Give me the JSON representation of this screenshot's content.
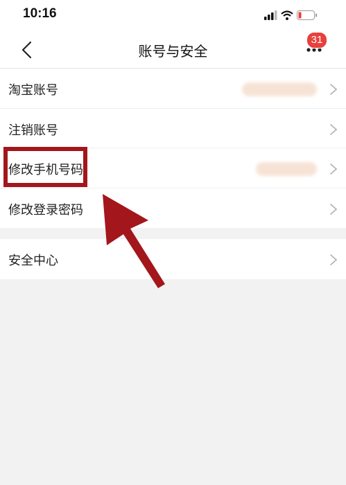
{
  "status_bar": {
    "time": "10:16"
  },
  "nav": {
    "title": "账号与安全",
    "badge_count": "31"
  },
  "settings_group_1": {
    "items": [
      {
        "label": "淘宝账号"
      },
      {
        "label": "注销账号"
      },
      {
        "label": "修改手机号码"
      },
      {
        "label": "修改登录密码"
      }
    ]
  },
  "settings_group_2": {
    "items": [
      {
        "label": "安全中心"
      }
    ]
  },
  "colors": {
    "highlight": "#a3161b",
    "badge": "#e8403d",
    "blurred_value": "#f6dfcf"
  }
}
